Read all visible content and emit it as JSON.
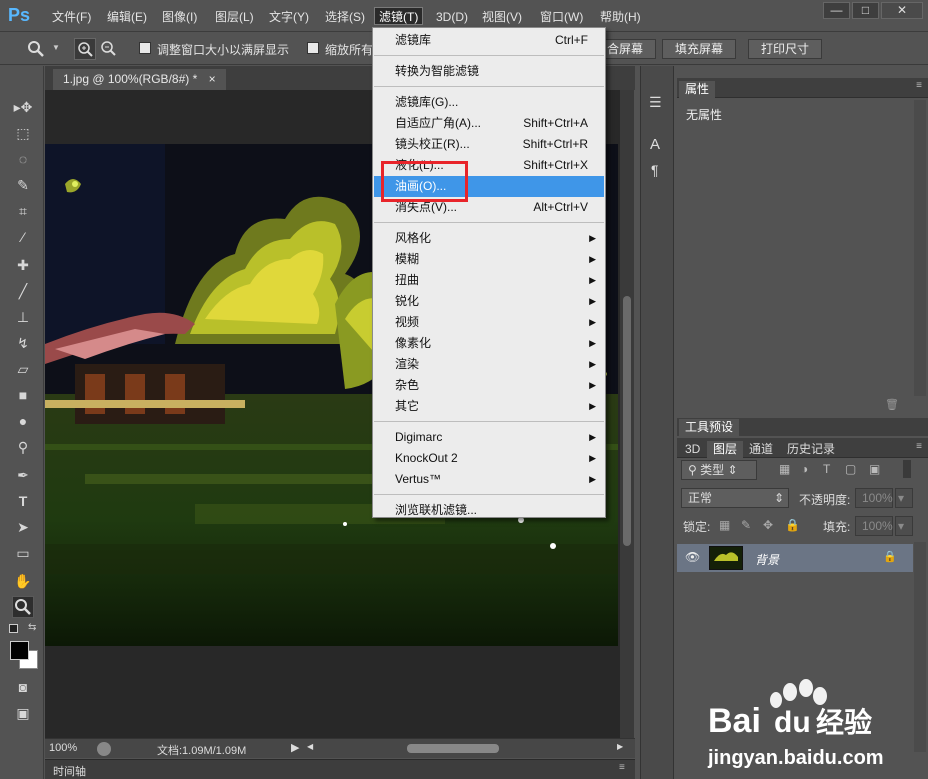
{
  "app": {
    "logo": "Ps"
  },
  "menubar": {
    "items": [
      "文件(F)",
      "编辑(E)",
      "图像(I)",
      "图层(L)",
      "文字(Y)",
      "选择(S)",
      "滤镜(T)",
      "3D(D)",
      "视图(V)",
      "窗口(W)",
      "帮助(H)"
    ],
    "active": "滤镜(T)"
  },
  "window_controls": {
    "minimize": "—",
    "maximize": "□",
    "close": "✕"
  },
  "optionsbar": {
    "resize_windows_label": "调整窗口大小以满屏显示",
    "zoom_all_label": "缩放所有",
    "fit_screen_partial": "合屏幕",
    "fill_screen_label": "填充屏幕",
    "print_size_label": "打印尺寸"
  },
  "document": {
    "tab_title": "1.jpg @ 100%(RGB/8#) *",
    "tab_close": "×"
  },
  "statusbar": {
    "zoom": "100%",
    "doc_info": "文档:1.09M/1.09M"
  },
  "timeline": {
    "label": "时间轴"
  },
  "filter_menu": {
    "groups": [
      [
        {
          "label": "滤镜库",
          "shortcut": "Ctrl+F"
        }
      ],
      [
        {
          "label": "转换为智能滤镜"
        }
      ],
      [
        {
          "label": "滤镜库(G)..."
        },
        {
          "label": "自适应广角(A)...",
          "shortcut": "Shift+Ctrl+A"
        },
        {
          "label": "镜头校正(R)...",
          "shortcut": "Shift+Ctrl+R"
        },
        {
          "label": "液化(L)...",
          "shortcut": "Shift+Ctrl+X"
        },
        {
          "label": "油画(O)...",
          "highlighted": true
        },
        {
          "label": "消失点(V)...",
          "shortcut": "Alt+Ctrl+V"
        }
      ],
      [
        {
          "label": "风格化",
          "submenu": true
        },
        {
          "label": "模糊",
          "submenu": true
        },
        {
          "label": "扭曲",
          "submenu": true
        },
        {
          "label": "锐化",
          "submenu": true
        },
        {
          "label": "视频",
          "submenu": true
        },
        {
          "label": "像素化",
          "submenu": true
        },
        {
          "label": "渲染",
          "submenu": true
        },
        {
          "label": "杂色",
          "submenu": true
        },
        {
          "label": "其它",
          "submenu": true
        }
      ],
      [
        {
          "label": "Digimarc",
          "submenu": true
        },
        {
          "label": "KnockOut 2",
          "submenu": true
        },
        {
          "label": "Vertus™",
          "submenu": true
        }
      ],
      [
        {
          "label": "浏览联机滤镜..."
        }
      ]
    ],
    "highlight_color": "#3f96e8",
    "callout_color": "#e8242a"
  },
  "properties_panel": {
    "tab": "属性",
    "content": "无属性"
  },
  "tool_presets_tab": "工具预设",
  "layers_panel": {
    "tabs": [
      "3D",
      "图层",
      "通道",
      "历史记录"
    ],
    "active_tab": "图层",
    "filter_kind": "类型",
    "blend_mode": "正常",
    "opacity_label": "不透明度:",
    "opacity_value": "100%",
    "lock_label": "锁定:",
    "fill_label": "填充:",
    "fill_value": "100%",
    "layers": [
      {
        "name": "背景",
        "visible": true,
        "locked": true
      }
    ]
  },
  "watermark": {
    "brand": "Bai经验",
    "url": "jingyan.baidu.com"
  }
}
